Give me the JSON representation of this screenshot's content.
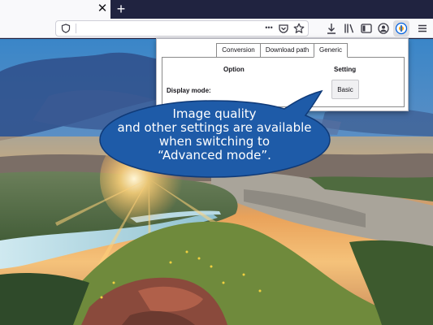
{
  "browser": {
    "tab_close_glyph": "✕",
    "new_tab_glyph": "+",
    "url_value": "",
    "url_more_glyph": "•••",
    "colors": {
      "tabstrip": "#202340",
      "toolbar": "#f9f9fb",
      "accent": "#0060df"
    }
  },
  "popup": {
    "tabs": [
      {
        "label": "Conversion"
      },
      {
        "label": "Download path"
      },
      {
        "label": "Generic"
      }
    ],
    "active_tab": "Generic",
    "headers": {
      "option": "Option",
      "setting": "Setting"
    },
    "display_mode": {
      "label": "Display mode:",
      "value": "Basic"
    }
  },
  "callout": {
    "lines": [
      "Image quality",
      "and other settings are available",
      "when switching to",
      "“Advanced mode”."
    ],
    "fill": "#1e5ba8"
  },
  "icons": {
    "toolbar": [
      "tracking-shield-icon",
      "pocket-icon",
      "bookmark-star-icon",
      "download-icon",
      "library-icon",
      "sidebar-icon",
      "account-icon",
      "extension-icon",
      "menu-icon"
    ]
  }
}
